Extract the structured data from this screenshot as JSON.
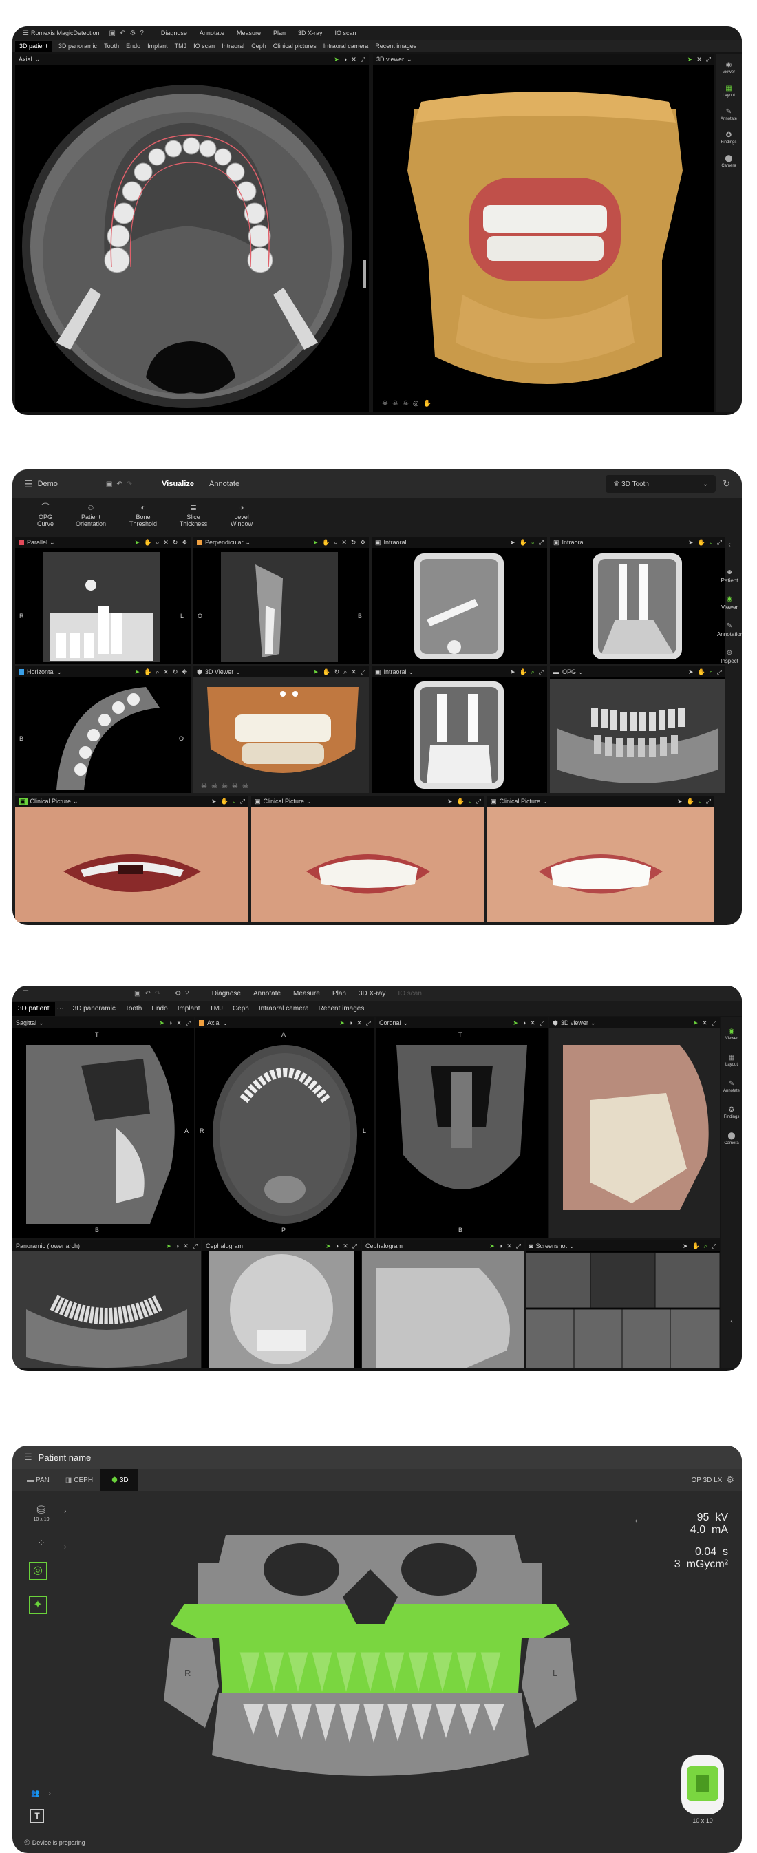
{
  "p1": {
    "app_title": "Romexis MagicDetection",
    "menu": [
      "Diagnose",
      "Annotate",
      "Measure",
      "Plan",
      "3D X-ray",
      "IO scan"
    ],
    "tabs": [
      "3D patient",
      "3D panoramic",
      "Tooth",
      "Endo",
      "Implant",
      "TMJ",
      "IO scan",
      "Intraoral",
      "Ceph",
      "Clinical pictures",
      "Intraoral camera",
      "Recent images"
    ],
    "active_tab": "3D patient",
    "left_view": "Axial",
    "right_view": "3D viewer",
    "sidebar": [
      "Viewer",
      "Layout",
      "Annotate",
      "Findings",
      "Camera"
    ]
  },
  "p2": {
    "menu_label": "Demo",
    "nav": [
      "Visualize",
      "Annotate"
    ],
    "mode_label": "3D Tooth",
    "tools": [
      {
        "l1": "OPG",
        "l2": "Curve"
      },
      {
        "l1": "Patient",
        "l2": "Orientation"
      },
      {
        "l1": "Bone",
        "l2": "Threshold"
      },
      {
        "l1": "Slice",
        "l2": "Thickness"
      },
      {
        "l1": "Level",
        "l2": "Window"
      }
    ],
    "row1": [
      "Parallel",
      "Perpendicular",
      "Intraoral",
      "Intraoral"
    ],
    "row2": [
      "Horizontal",
      "3D Viewer",
      "Intraoral",
      "OPG"
    ],
    "row3": [
      "Clinical Picture",
      "Clinical Picture",
      "Clinical Picture"
    ],
    "sidebar": [
      "Patient",
      "Viewer",
      "Annotation",
      "Inspect"
    ],
    "lbl_r": "R",
    "lbl_l": "L",
    "lbl_o": "O",
    "lbl_b": "B"
  },
  "p3": {
    "menu": [
      "Diagnose",
      "Annotate",
      "Measure",
      "Plan",
      "3D X-ray",
      "IO scan"
    ],
    "tabs": [
      "3D patient",
      "3D panoramic",
      "Tooth",
      "Endo",
      "Implant",
      "TMJ",
      "Ceph",
      "Intraoral camera",
      "Recent images"
    ],
    "row1": [
      "Sagittal",
      "Axial",
      "Coronal",
      "3D viewer"
    ],
    "row2": [
      "Panoramic (lower arch)",
      "Cephalogram",
      "Cephalogram",
      "Screenshot"
    ],
    "sidebar": [
      "Viewer",
      "Layout",
      "Annotate",
      "Findings",
      "Camera"
    ],
    "lbl_t": "T",
    "lbl_a": "A",
    "lbl_p": "P",
    "lbl_b": "B",
    "lbl_r": "R",
    "lbl_l": "L"
  },
  "p4": {
    "patient": "Patient name",
    "modes": [
      "PAN",
      "CEPH",
      "3D"
    ],
    "active_mode": "3D",
    "device": "OP 3D LX",
    "fov_label": "10 x 10",
    "kv": "95",
    "kv_unit": "kV",
    "ma": "4.0",
    "ma_unit": "mA",
    "time": "0.04",
    "time_unit": "s",
    "dose": "3",
    "dose_unit": "mGycm²",
    "lbl_r": "R",
    "lbl_l": "L",
    "fov_badge": "10 x 10",
    "status": "Device is preparing"
  }
}
